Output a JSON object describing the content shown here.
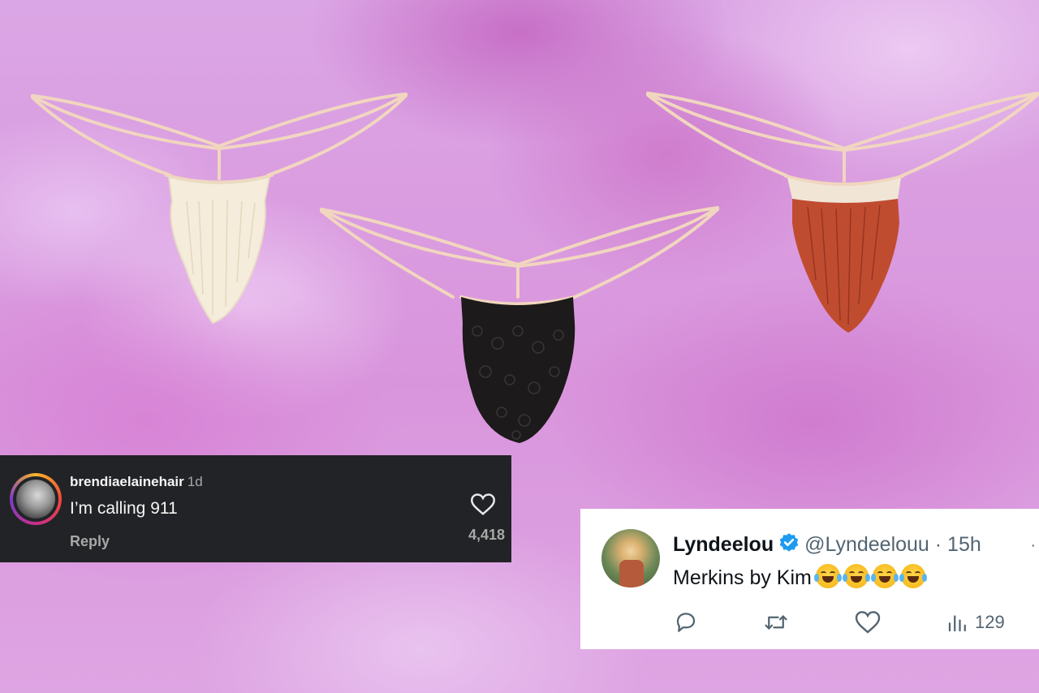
{
  "background": {
    "color": "#dca8e6",
    "icon": "pink-cloud-sky"
  },
  "products": [
    {
      "name": "blonde",
      "color": "#f3ead9"
    },
    {
      "name": "black",
      "color": "#1d1b1b"
    },
    {
      "name": "red",
      "color": "#c04c30"
    }
  ],
  "instagram_comment": {
    "username": "brendiaelainehair",
    "time": "1d",
    "text": "I’m calling 911",
    "reply_label": "Reply",
    "likes": "4,418",
    "heart_icon": "heart-outline-icon"
  },
  "tweet": {
    "name": "Lyndeelou",
    "verified_icon": "verified-badge-icon",
    "handle_time": "@Lyndeelouu · 15h",
    "text": "Merkins by Kim",
    "emoji_icon": "face-with-tears-of-joy-icon",
    "emoji_count": 4,
    "views": "129",
    "more": "·",
    "actions": [
      "reply-icon",
      "retweet-icon",
      "like-icon",
      "views-icon"
    ]
  }
}
